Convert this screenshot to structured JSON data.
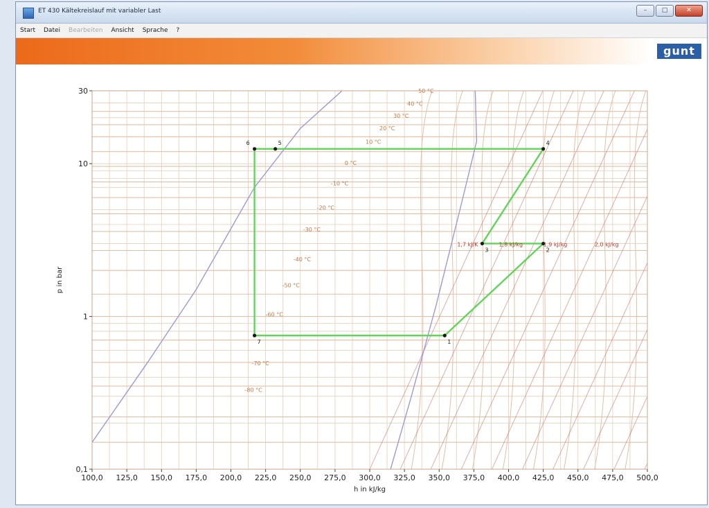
{
  "window": {
    "title": "ET 430 Kältekreislauf mit variabler Last",
    "buttons": {
      "minimize": "–",
      "maximize": "□",
      "close": "✕"
    }
  },
  "menu": {
    "items": [
      {
        "label": "Start",
        "enabled": true
      },
      {
        "label": "Datei",
        "enabled": true
      },
      {
        "label": "Bearbeiten",
        "enabled": false
      },
      {
        "label": "Ansicht",
        "enabled": true
      },
      {
        "label": "Sprache",
        "enabled": true
      },
      {
        "label": "?",
        "enabled": true
      }
    ]
  },
  "brand": {
    "logo_text": "gunt",
    "colors": {
      "bar_start": "#ec6a1a",
      "logo_bg": "#2b5fa8"
    }
  },
  "chart_data": {
    "type": "line",
    "title": "",
    "xlabel": "h in kJ/kg",
    "ylabel": "p in bar",
    "xlim": [
      100,
      500
    ],
    "ylim": [
      0.1,
      30
    ],
    "y_scale": "log",
    "grid": true,
    "x_ticks": [
      "100,0",
      "125,0",
      "150,0",
      "175,0",
      "200,0",
      "225,0",
      "250,0",
      "275,0",
      "300,0",
      "325,0",
      "350,0",
      "375,0",
      "400,0",
      "425,0",
      "450,0",
      "475,0",
      "500,0"
    ],
    "y_ticks": [
      "30",
      "10",
      "1",
      "0,1"
    ],
    "isotherm_labels": [
      "50 °C",
      "40 °C",
      "30 °C",
      "20 °C",
      "10 °C",
      "0 °C",
      "-10 °C",
      "-20 °C",
      "-30 °C",
      "-40 °C",
      "-50 °C",
      "-60 °C",
      "-70 °C",
      "-80 °C"
    ],
    "entropy_labels": [
      "1,7 kJ/K",
      "1,8 kJ/kg",
      "1,9 kJ/kg",
      "2,0 kJ/kg"
    ],
    "cycle": {
      "color": "#5fd65a",
      "points": [
        {
          "label": "1",
          "h": 354,
          "p": 0.75
        },
        {
          "label": "2",
          "h": 425,
          "p": 3.0
        },
        {
          "label": "3",
          "h": 381,
          "p": 3.0
        },
        {
          "label": "4",
          "h": 425,
          "p": 12.5
        },
        {
          "label": "5",
          "h": 232,
          "p": 12.5
        },
        {
          "label": "6",
          "h": 217,
          "p": 12.5
        },
        {
          "label": "7",
          "h": 217,
          "p": 0.75
        }
      ],
      "path": [
        "1",
        "2",
        "3",
        "4",
        "6",
        "7",
        "1"
      ]
    },
    "saturation": {
      "color": "#9a9ad8",
      "liquid": [
        {
          "h": 100,
          "p": 0.15
        },
        {
          "h": 140,
          "p": 0.5
        },
        {
          "h": 175,
          "p": 1.5
        },
        {
          "h": 217,
          "p": 7
        },
        {
          "h": 250,
          "p": 17
        },
        {
          "h": 280,
          "p": 30
        }
      ],
      "vapour": [
        {
          "h": 315,
          "p": 0.1
        },
        {
          "h": 330,
          "p": 0.3
        },
        {
          "h": 348,
          "p": 1.2
        },
        {
          "h": 365,
          "p": 5
        },
        {
          "h": 377,
          "p": 14
        },
        {
          "h": 376,
          "p": 30
        }
      ]
    },
    "colors": {
      "grid": "#e8cdb8",
      "isotherm": "#e3bfa6",
      "isentrope": "#c96b5b",
      "label": "#c27a46",
      "entropy_label": "#c0392b"
    }
  }
}
